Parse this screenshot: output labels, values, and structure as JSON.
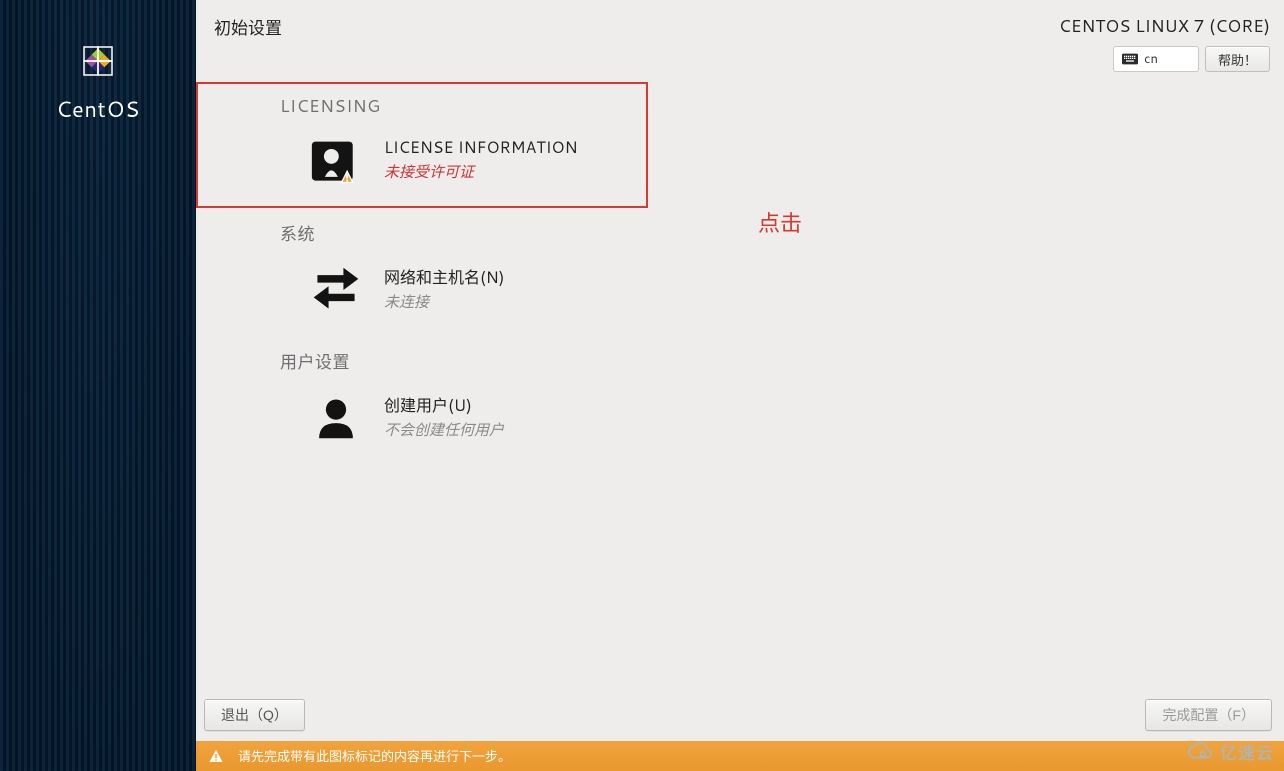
{
  "header": {
    "title": "初始设置",
    "distro": "CENTOS LINUX 7 (CORE)",
    "keyboard_layout": "cn",
    "help_label": "帮助！"
  },
  "sidebar": {
    "brand": "CentOS"
  },
  "sections": {
    "licensing": {
      "title": "LICENSING",
      "spoke_label": "LICENSE INFORMATION",
      "spoke_status": "未接受许可证"
    },
    "system": {
      "title": "系统",
      "spoke_label": "网络和主机名(N)",
      "spoke_status": "未连接"
    },
    "user": {
      "title": "用户设置",
      "spoke_label": "创建用户(U)",
      "spoke_status": "不会创建任何用户"
    }
  },
  "annotation": {
    "click_hint": "点击"
  },
  "footer": {
    "quit_label": "退出（Q）",
    "finish_label": "完成配置（F）"
  },
  "warning_bar": {
    "message": "请先完成带有此图标标记的内容再进行下一步。"
  },
  "watermark": {
    "text": "亿速云"
  },
  "colors": {
    "highlight": "#d43a2f",
    "warn_text": "#c83737",
    "bg": "#eeedec"
  }
}
